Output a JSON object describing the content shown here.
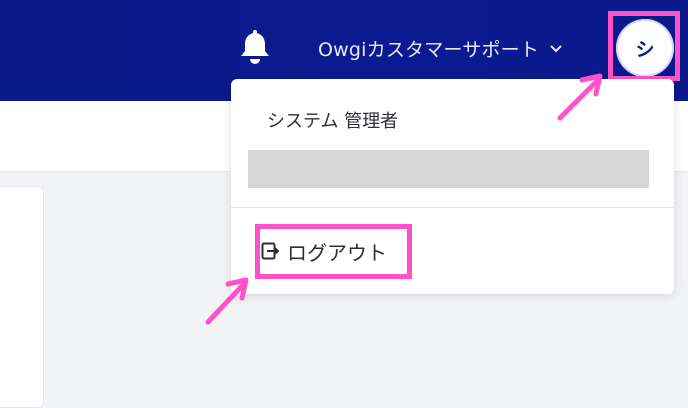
{
  "header": {
    "account_name": "Owgiカスタマーサポート",
    "avatar_initial": "シ",
    "icons": {
      "notifications": "bell-icon",
      "menu": "chevron-down-icon"
    }
  },
  "dropdown": {
    "user_name": "システム 管理者",
    "logout_label": "ログアウト",
    "logout_icon": "logout-icon"
  },
  "colors": {
    "header_bg": "#0a1a86",
    "highlight": "#ff52c9",
    "page_bg": "#f2f3f6"
  }
}
